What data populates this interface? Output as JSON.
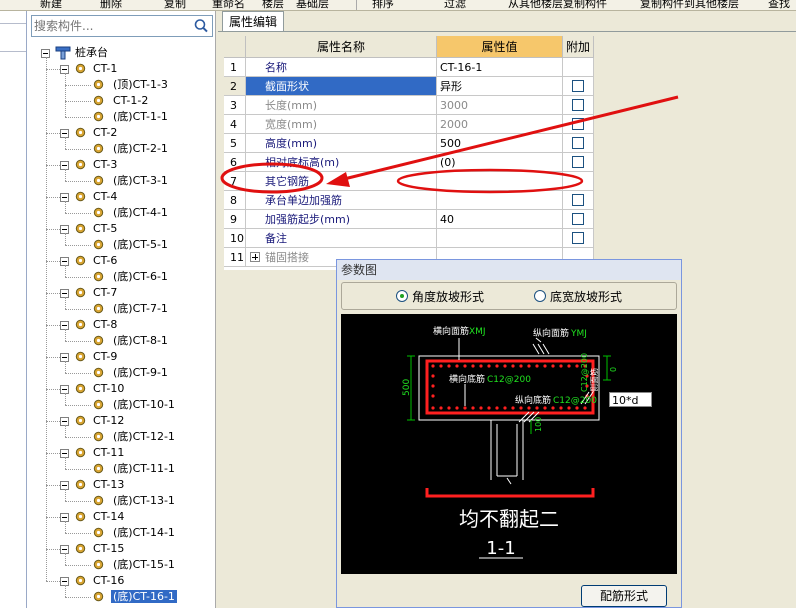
{
  "toolbar": {
    "items": [
      "新建",
      "删除",
      "复制",
      "重命名",
      "楼层",
      "基础层",
      "排序",
      "过滤",
      "从其他楼层复制构件",
      "复制构件到其他楼层",
      "查找"
    ]
  },
  "tree": {
    "search_placeholder": "搜索构件...",
    "root": "桩承台",
    "groups": [
      {
        "label": "CT-1",
        "children": [
          "(顶)CT-1-3",
          "CT-1-2",
          "(底)CT-1-1"
        ]
      },
      {
        "label": "CT-2",
        "children": [
          "(底)CT-2-1"
        ]
      },
      {
        "label": "CT-3",
        "children": [
          "(底)CT-3-1"
        ]
      },
      {
        "label": "CT-4",
        "children": [
          "(底)CT-4-1"
        ]
      },
      {
        "label": "CT-5",
        "children": [
          "(底)CT-5-1"
        ]
      },
      {
        "label": "CT-6",
        "children": [
          "(底)CT-6-1"
        ]
      },
      {
        "label": "CT-7",
        "children": [
          "(底)CT-7-1"
        ]
      },
      {
        "label": "CT-8",
        "children": [
          "(底)CT-8-1"
        ]
      },
      {
        "label": "CT-9",
        "children": [
          "(底)CT-9-1"
        ]
      },
      {
        "label": "CT-10",
        "children": [
          "(底)CT-10-1"
        ]
      },
      {
        "label": "CT-12",
        "children": [
          "(底)CT-12-1"
        ]
      },
      {
        "label": "CT-11",
        "children": [
          "(底)CT-11-1"
        ]
      },
      {
        "label": "CT-13",
        "children": [
          "(底)CT-13-1"
        ]
      },
      {
        "label": "CT-14",
        "children": [
          "(底)CT-14-1"
        ]
      },
      {
        "label": "CT-15",
        "children": [
          "(底)CT-15-1"
        ]
      },
      {
        "label": "CT-16",
        "children": [
          "(底)CT-16-1"
        ]
      }
    ],
    "selected": "(底)CT-16-1"
  },
  "editor": {
    "tab": "属性编辑",
    "headers": {
      "name": "属性名称",
      "value": "属性值",
      "extra": "附加"
    },
    "rows": [
      {
        "num": "1",
        "name": "名称",
        "value": "CT-16-1",
        "check": false
      },
      {
        "num": "2",
        "name": "截面形状",
        "value": "异形",
        "check": true
      },
      {
        "num": "3",
        "name": "长度(mm)",
        "value": "3000",
        "check": true
      },
      {
        "num": "4",
        "name": "宽度(mm)",
        "value": "2000",
        "check": true
      },
      {
        "num": "5",
        "name": "高度(mm)",
        "value": "500",
        "check": true
      },
      {
        "num": "6",
        "name": "相对底标高(m)",
        "value": "(0)",
        "check": true
      },
      {
        "num": "7",
        "name": "其它钢筋",
        "value": "",
        "check": false
      },
      {
        "num": "8",
        "name": "承台单边加强筋",
        "value": "",
        "check": true
      },
      {
        "num": "9",
        "name": "加强筋起步(mm)",
        "value": "40",
        "check": true
      },
      {
        "num": "10",
        "name": "备注",
        "value": "",
        "check": true
      },
      {
        "num": "11",
        "name": "锚固搭接",
        "value": "",
        "check": false
      }
    ]
  },
  "dialog": {
    "title": "参数图",
    "option1": "角度放坡形式",
    "option2": "底宽放坡形式",
    "button": "配筋形式",
    "drawing": {
      "label_top_h": "横向面筋",
      "label_top_h_code": "XMJ",
      "label_top_v": "纵向面筋",
      "label_top_v_code": "YMJ",
      "label_bot_h": "横向底筋",
      "label_bot_h_code": "C12@200",
      "label_bot_v": "纵向底筋",
      "label_bot_v_code": "C12@200",
      "label_side": "侧面筋",
      "label_side_code": "C12@200",
      "dim_height": "500",
      "dim_zero": "0",
      "dim_100": "100",
      "input_value": "10*d",
      "caption": "均不翻起二",
      "section": "1-1"
    }
  },
  "colors": {
    "selection": "#316ac5",
    "header_value": "#f6c76b",
    "annotation": "#e01010",
    "canvas": "#000000"
  }
}
